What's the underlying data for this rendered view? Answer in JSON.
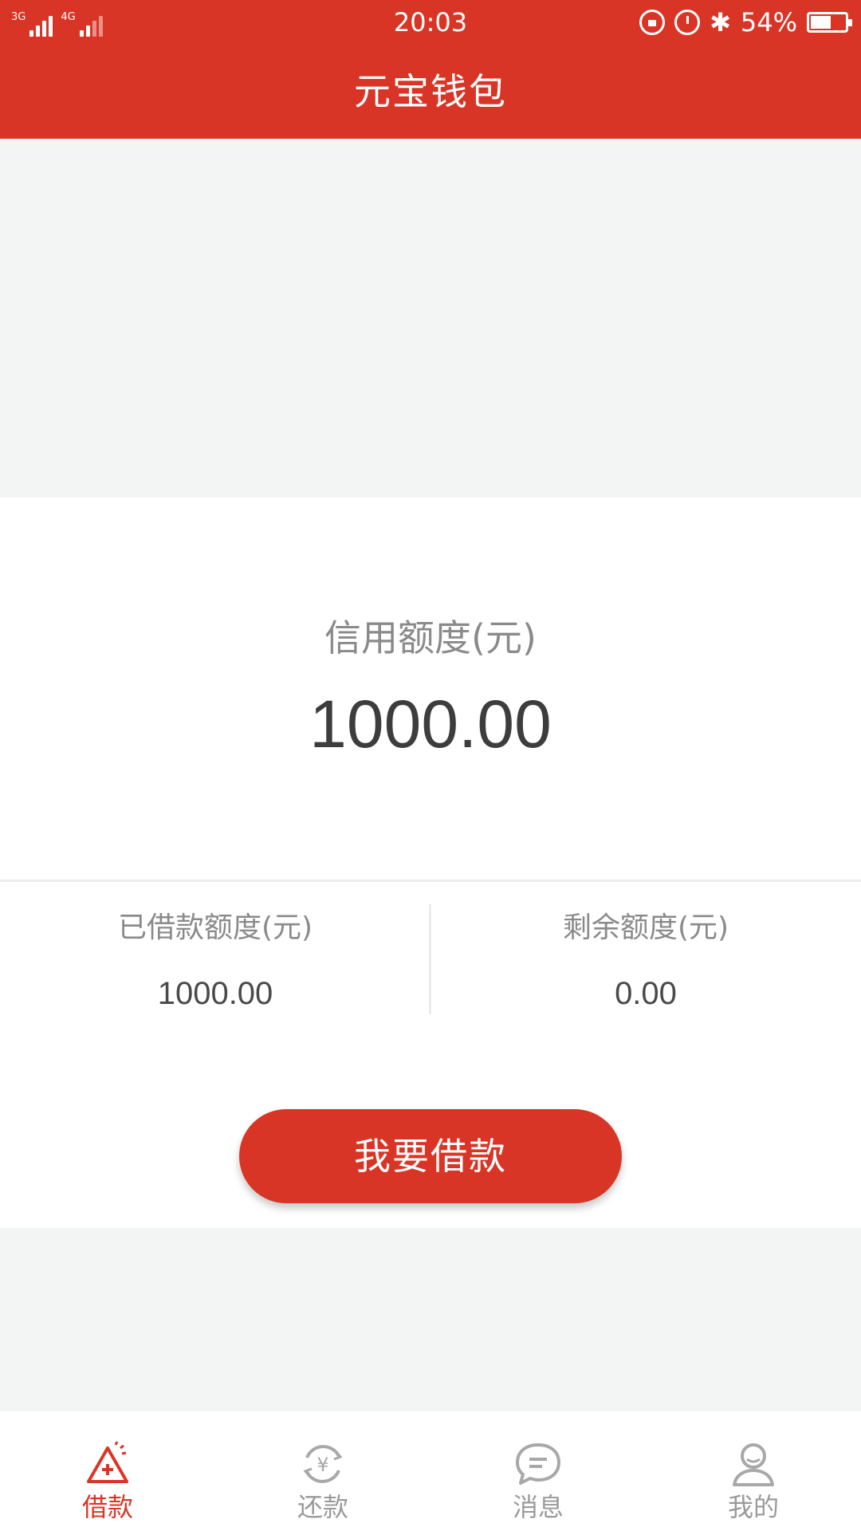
{
  "status_bar": {
    "network_1": "3G",
    "network_2": "4G",
    "time": "20:03",
    "battery_percent": "54%",
    "battery_level": 0.54,
    "icons": [
      "lock-rotation-icon",
      "alarm-icon",
      "bluetooth-icon",
      "battery-icon"
    ]
  },
  "header": {
    "title": "元宝钱包"
  },
  "credit": {
    "label": "信用额度(元)",
    "value": "1000.00"
  },
  "stats": {
    "borrowed_label": "已借款额度(元)",
    "borrowed_value": "1000.00",
    "remaining_label": "剩余额度(元)",
    "remaining_value": "0.00"
  },
  "actions": {
    "borrow_button": "我要借款"
  },
  "tabbar": {
    "items": [
      {
        "label": "借款",
        "icon": "borrow-icon",
        "active": true
      },
      {
        "label": "还款",
        "icon": "repay-icon",
        "active": false
      },
      {
        "label": "消息",
        "icon": "message-icon",
        "active": false
      },
      {
        "label": "我的",
        "icon": "profile-icon",
        "active": false
      }
    ]
  },
  "colors": {
    "brand_red": "#d93526",
    "background_grey": "#f3f4f4",
    "inactive_grey": "#9a9a9a",
    "value_text": "#3d3d3d"
  }
}
